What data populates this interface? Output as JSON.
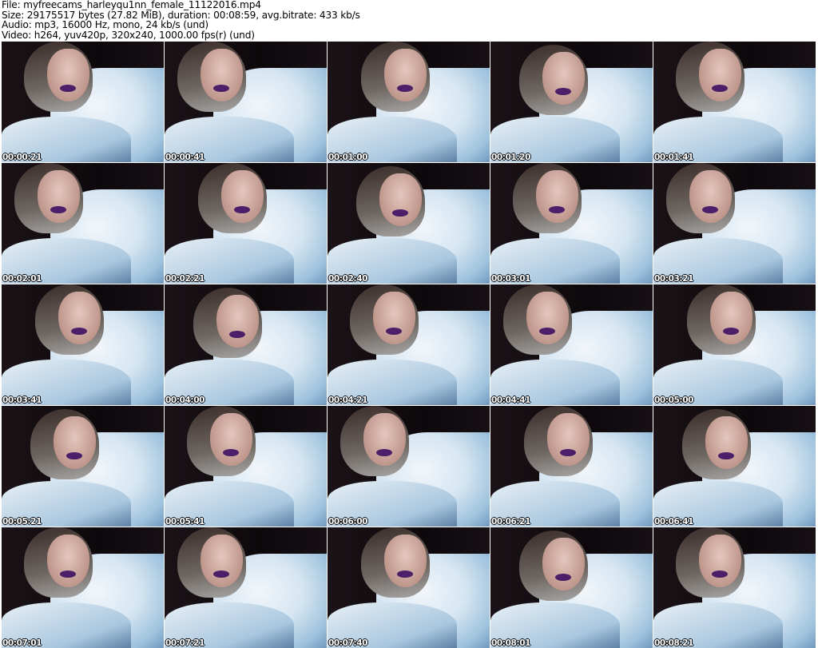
{
  "header": {
    "file": "File: myfreecams_harleyqu1nn_female_11122016.mp4",
    "size": "Size: 29175517 bytes (27.82 MiB), duration: 00:08:59, avg.bitrate: 433 kb/s",
    "audio": "Audio: mp3, 16000 Hz, mono, 24 kb/s (und)",
    "video": "Video: h264, yuv420p, 320x240, 1000.00 fps(r) (und)"
  },
  "thumbnails": [
    {
      "timestamp": "00:00:21"
    },
    {
      "timestamp": "00:00:41"
    },
    {
      "timestamp": "00:01:00"
    },
    {
      "timestamp": "00:01:20"
    },
    {
      "timestamp": "00:01:41"
    },
    {
      "timestamp": "00:02:01"
    },
    {
      "timestamp": "00:02:21"
    },
    {
      "timestamp": "00:02:40"
    },
    {
      "timestamp": "00:03:01"
    },
    {
      "timestamp": "00:03:21"
    },
    {
      "timestamp": "00:03:41"
    },
    {
      "timestamp": "00:04:00"
    },
    {
      "timestamp": "00:04:21"
    },
    {
      "timestamp": "00:04:41"
    },
    {
      "timestamp": "00:05:00"
    },
    {
      "timestamp": "00:05:21"
    },
    {
      "timestamp": "00:05:41"
    },
    {
      "timestamp": "00:06:00"
    },
    {
      "timestamp": "00:06:21"
    },
    {
      "timestamp": "00:06:41"
    },
    {
      "timestamp": "00:07:01"
    },
    {
      "timestamp": "00:07:21"
    },
    {
      "timestamp": "00:07:40"
    },
    {
      "timestamp": "00:08:01"
    },
    {
      "timestamp": "00:08:21"
    }
  ]
}
